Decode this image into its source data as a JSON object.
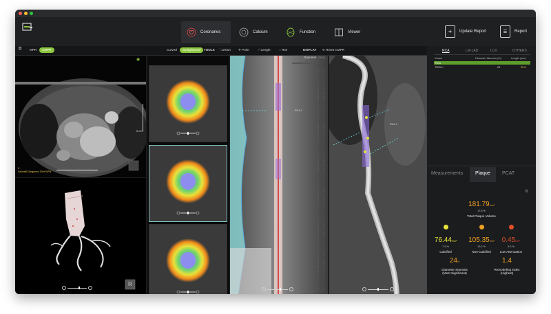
{
  "app": {
    "nav": [
      {
        "label": "Coronaries",
        "icon": "heart-icon"
      },
      {
        "label": "Calcium",
        "icon": "calcium-icon"
      },
      {
        "label": "Function",
        "icon": "function-icon"
      },
      {
        "label": "Viewer",
        "icon": "viewer-icon"
      }
    ],
    "update_report": "Update Report",
    "report": "Report"
  },
  "toolbar": {
    "mode_mpr": "MPR",
    "mode_cmpr": "CMPR",
    "view_curved": "Curved",
    "view_straightened": "Straightened",
    "tools_label": "TOOLS",
    "tool_lesion": "Lesion",
    "tool_point": "Point",
    "tool_length": "Length",
    "tool_roi": "ROI",
    "display_label": "DISPLAY",
    "reset_cmpr": "Reset CMPR",
    "diameter": "Diameter",
    "area": "Area"
  },
  "viewport": {
    "axial_measure": "6 mm",
    "series_line1": "2",
    "series_line2": "Series",
    "series_desc": "55 Segment 30% BPM",
    "label_rca1": "RCA 1",
    "orient_cube": "R"
  },
  "sidebar": {
    "vessel_tabs": [
      "RCA",
      "LM-LAD",
      "LCX",
      "OTHERS"
    ],
    "table_headers": {
      "vessel": "Vessel",
      "stenosis": "Diameter Stenosis (%)",
      "length": "Length (mm)"
    },
    "rows": [
      {
        "vessel": "RCA",
        "stenosis": "",
        "length": ""
      },
      {
        "vessel": "RCA 1:",
        "stenosis": "24",
        "length": "30.6"
      }
    ],
    "panel_tabs": [
      "Measurements",
      "Plaque",
      "PCAT"
    ],
    "plaque": {
      "total_volume": "181.79",
      "total_unit": "mm³",
      "total_pct": "17.6 %",
      "total_label": "Total Plaque Volume",
      "calcified": {
        "value": "76.44",
        "unit": "mm³",
        "pct": "7.4 %",
        "label": "Calcified",
        "color": "#e6e33a"
      },
      "noncalcified": {
        "value": "105.35",
        "unit": "mm³",
        "pct": "10.2 %",
        "label": "Non-Calcified",
        "color": "#f0a024"
      },
      "lowatt": {
        "value": "0.45",
        "unit": "mm³",
        "pct": "0.0 %",
        "label": "Low Attenuation",
        "color": "#e2502a"
      },
      "stenosis": {
        "value": "24",
        "unit": "%",
        "label1": "Diameter Stenosis",
        "label2": "(Most Significant)"
      },
      "remodeling": {
        "value": "1.4",
        "label1": "Remodeling Index",
        "label2": "(Highest)"
      }
    }
  },
  "colors": {
    "accent_green": "#8cc63e",
    "value_orange": "#f0a024",
    "rca_bar": "#5e9e2a"
  }
}
